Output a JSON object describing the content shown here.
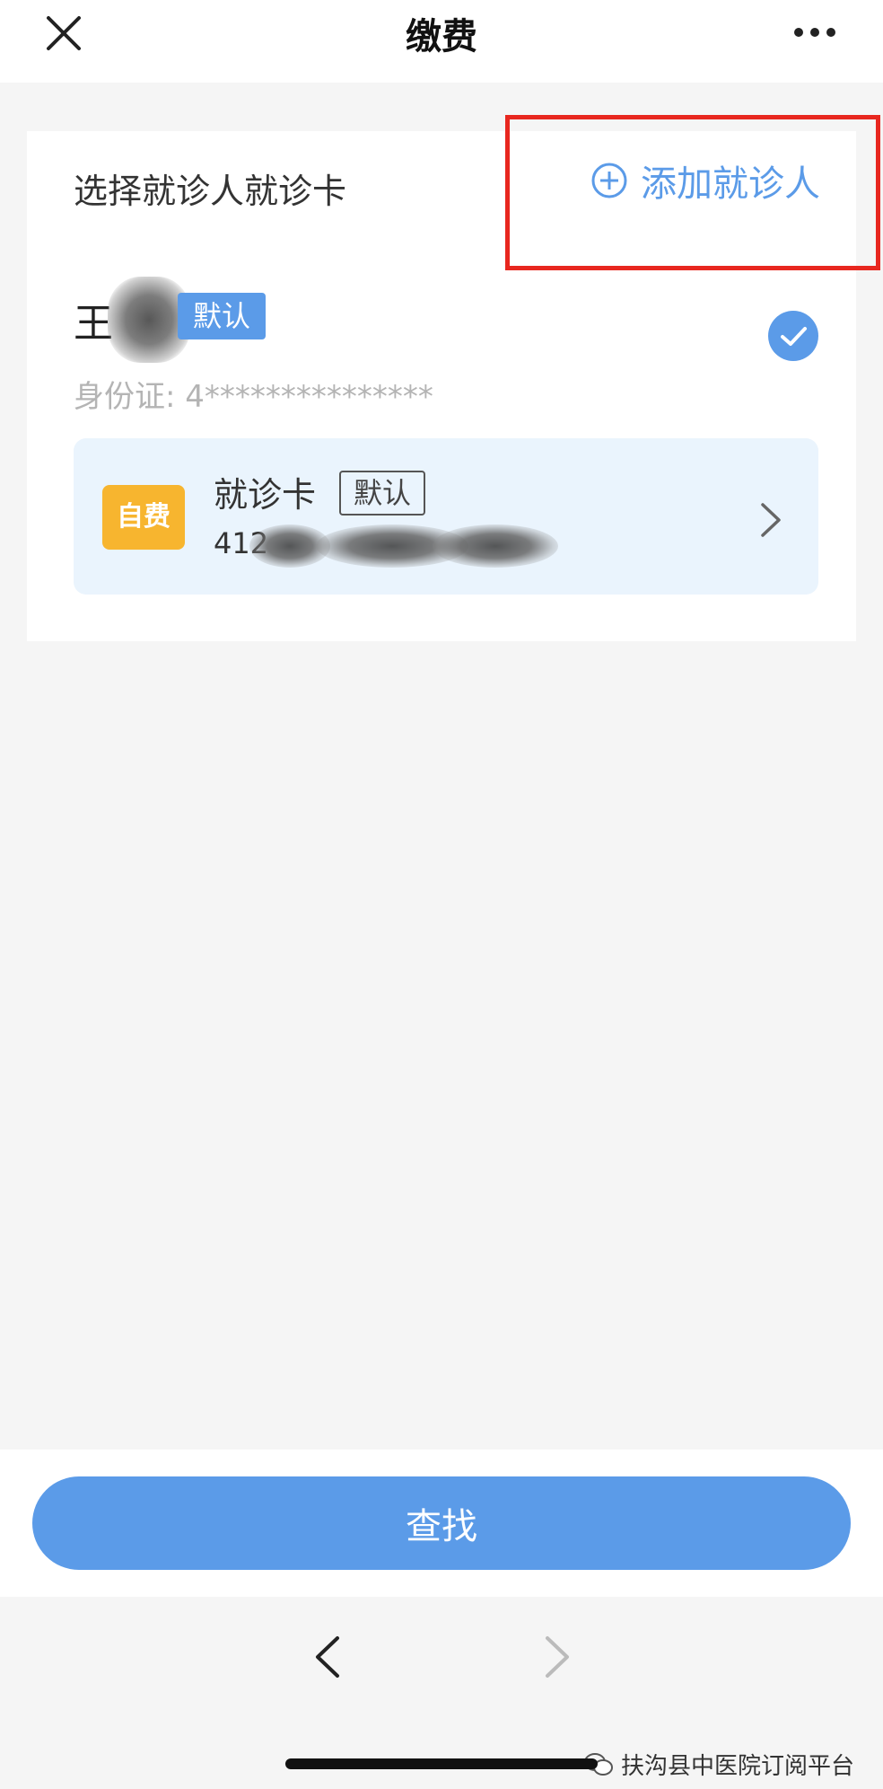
{
  "header": {
    "title": "缴费",
    "close_icon": "close-icon",
    "more_icon": "more-icon"
  },
  "card": {
    "section_title": "选择就诊人就诊卡",
    "add_patient_label": "添加就诊人",
    "add_icon": "plus-circle-icon",
    "patient": {
      "name": "王",
      "default_tag": "默认",
      "id_label": "身份证:",
      "id_value": "4***************",
      "selected": true
    },
    "medical_card": {
      "badge": "自费",
      "title": "就诊卡",
      "default_tag": "默认",
      "number_prefix": "412"
    }
  },
  "bottom": {
    "search_label": "查找"
  },
  "watermark": {
    "text": "扶沟县中医院订阅平台",
    "icon": "wechat-icon"
  },
  "colors": {
    "accent": "#5b9be8",
    "badge": "#f7b52f",
    "highlight": "#e8271f"
  }
}
